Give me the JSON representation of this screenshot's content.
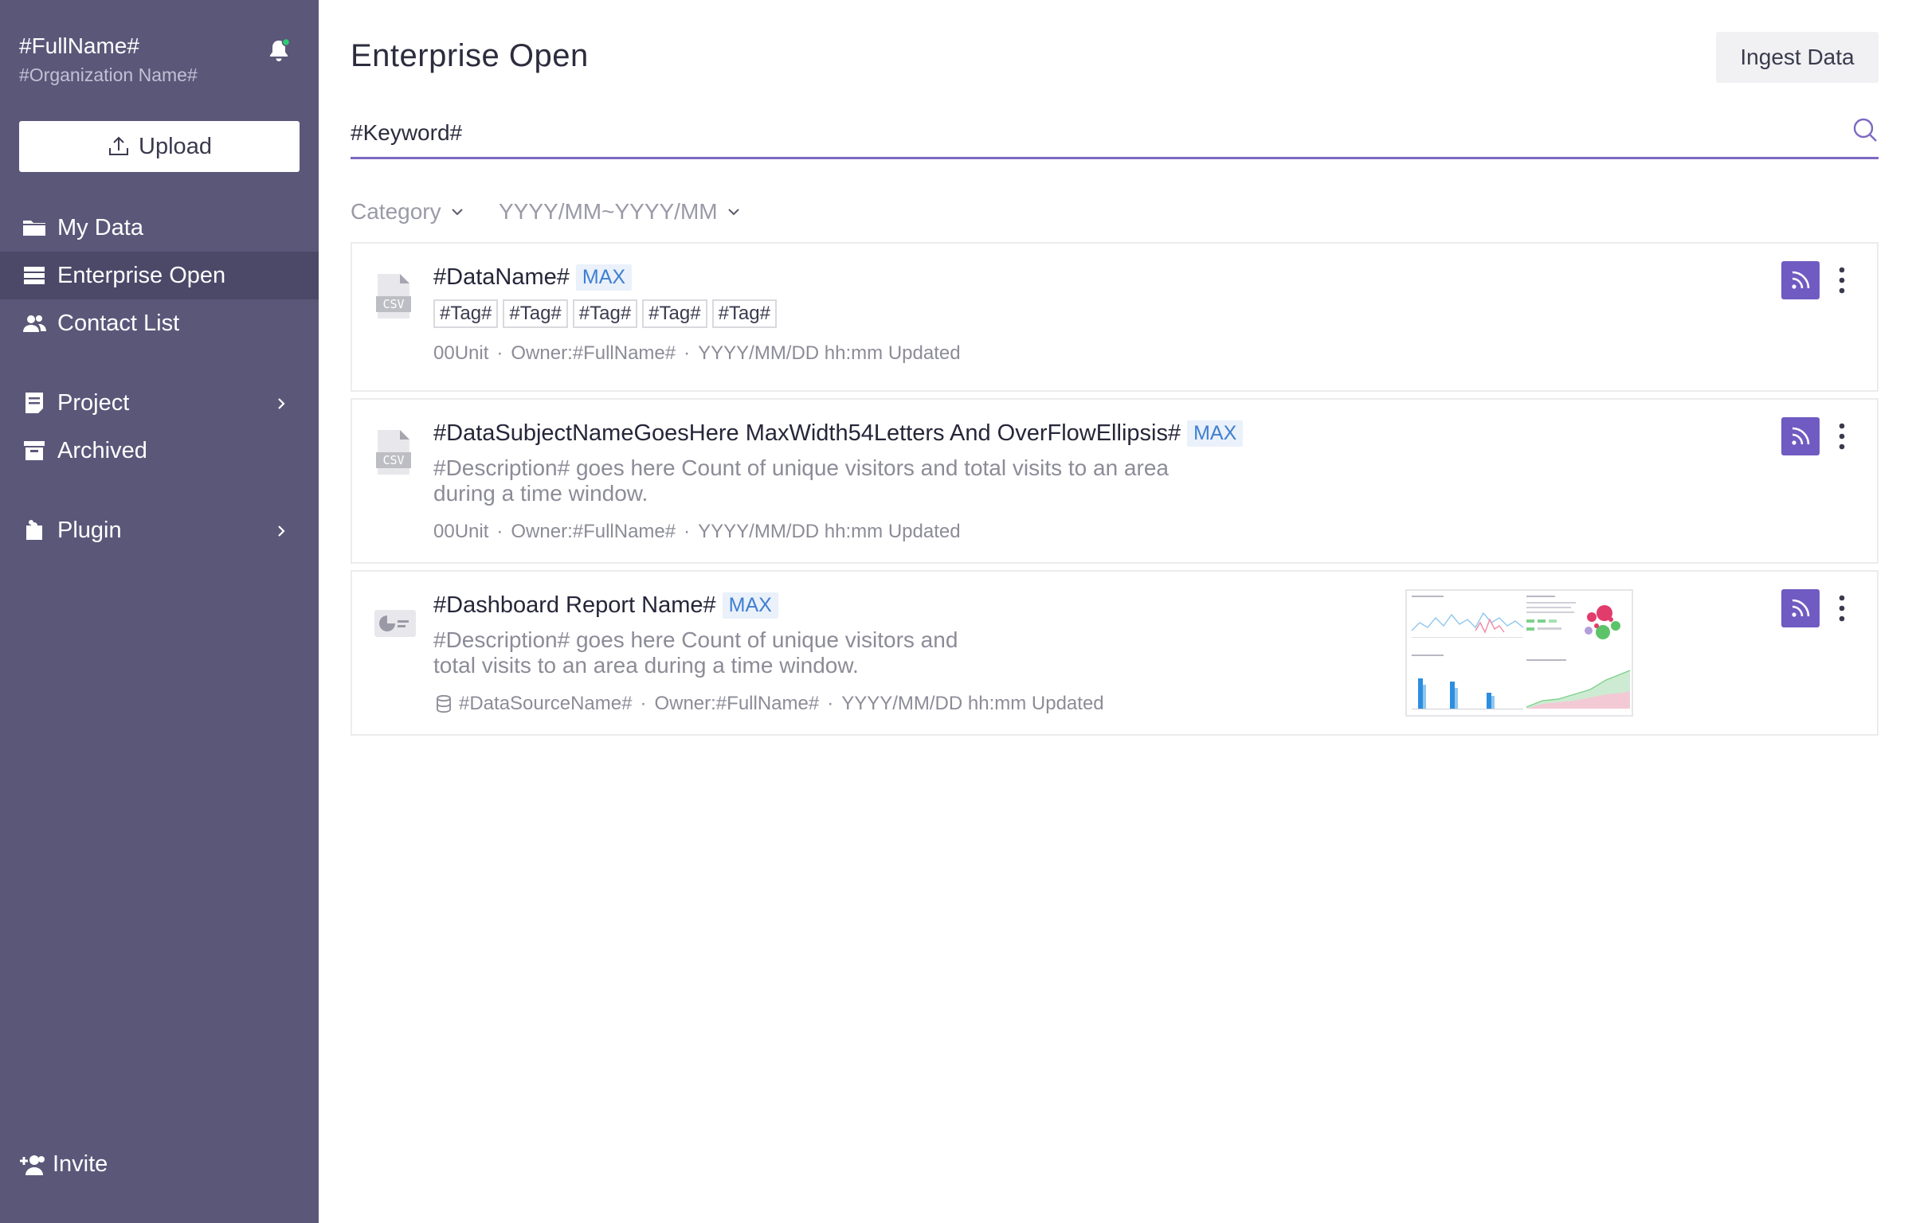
{
  "sidebar": {
    "user_name": "#FullName#",
    "org_name": "#Organization Name#",
    "upload_label": "Upload",
    "nav": [
      {
        "label": "My Data",
        "icon": "folder-icon"
      },
      {
        "label": "Enterprise Open",
        "icon": "list-icon",
        "active": true
      },
      {
        "label": "Contact List",
        "icon": "contacts-icon"
      },
      {
        "label": "Project",
        "icon": "document-icon",
        "has_submenu": true
      },
      {
        "label": "Archived",
        "icon": "archive-icon"
      },
      {
        "label": "Plugin",
        "icon": "puzzle-icon",
        "has_submenu": true
      }
    ],
    "invite_label": "Invite"
  },
  "header": {
    "title": "Enterprise Open",
    "ingest_label": "Ingest Data"
  },
  "search": {
    "placeholder": "#Keyword#"
  },
  "filters": {
    "category": "Category",
    "date_range": "YYYY/MM~YYYY/MM"
  },
  "items": [
    {
      "type": "csv",
      "icon_text": "CSV",
      "title": "#DataName#",
      "badge": "MAX",
      "tags": [
        "#Tag#",
        "#Tag#",
        "#Tag#",
        "#Tag#",
        "#Tag#"
      ],
      "meta": {
        "units": "00Unit",
        "owner": "Owner:#FullName#",
        "updated": "YYYY/MM/DD hh:mm Updated"
      }
    },
    {
      "type": "csv",
      "icon_text": "CSV",
      "title": "#DataSubjectNameGoesHere MaxWidth54Letters And OverFlowEllipsis#",
      "badge": "MAX",
      "description_line1": "#Description# goes here Count of unique visitors and total visits to an area",
      "description_line2": "during a time window.",
      "meta": {
        "units": "00Unit",
        "owner": "Owner:#FullName#",
        "updated": "YYYY/MM/DD hh:mm Updated"
      }
    },
    {
      "type": "dashboard",
      "title": "#Dashboard Report Name#",
      "badge": "MAX",
      "description_line1": "#Description# goes here Count of unique visitors and",
      "description_line2": "total visits to an area during a time window.",
      "meta": {
        "source": "#DataSourceName#",
        "owner": "Owner:#FullName#",
        "updated": "YYYY/MM/DD hh:mm Updated"
      }
    }
  ],
  "colors": {
    "sidebar_bg": "#5b5779",
    "sidebar_active": "#4b4868",
    "accent": "#6f5bc2",
    "badge_text": "#3f7fd0",
    "notification_dot": "#2ecc71"
  }
}
